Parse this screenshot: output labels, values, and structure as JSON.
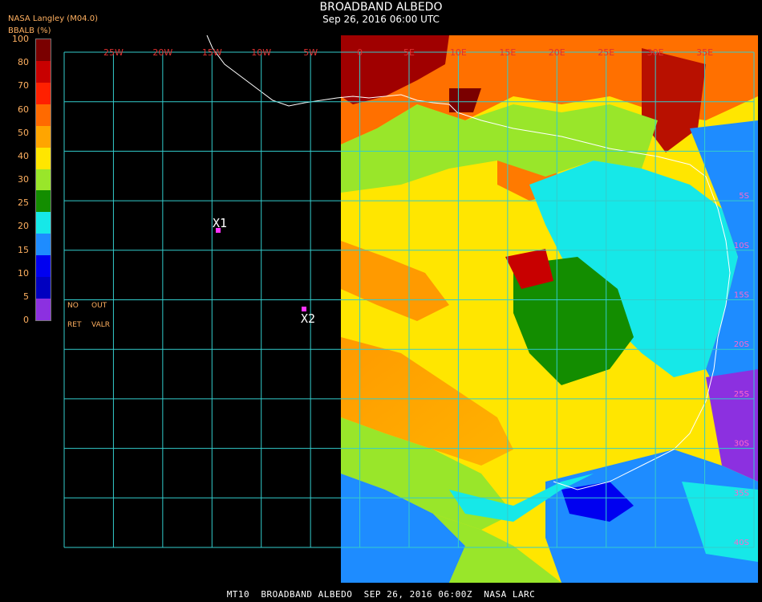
{
  "header": {
    "title": "BROADBAND ALBEDO",
    "subtitle": "Sep 26, 2016 06:00 UTC",
    "agency": "NASA Langley (M04.0)",
    "unit_label": "BBALB (%)"
  },
  "colorbar": {
    "ticks": [
      "100",
      "80",
      "70",
      "60",
      "50",
      "40",
      "30",
      "25",
      "20",
      "15",
      "10",
      "5",
      "0"
    ],
    "colors": [
      "#7a0000",
      "#c80000",
      "#ff2000",
      "#ff6a00",
      "#ffa500",
      "#ffe600",
      "#99e62a",
      "#138d00",
      "#16e8e8",
      "#1e8cff",
      "#0000f0",
      "#0000c0",
      "#8c30e0"
    ]
  },
  "legend_notes": {
    "no": "NO",
    "out": "OUT",
    "ret": "RET",
    "valr": "VALR"
  },
  "map": {
    "lon_labels": [
      "25W",
      "20W",
      "15W",
      "10W",
      "5W",
      "0",
      "5E",
      "10E",
      "15E",
      "20E",
      "25E",
      "30E",
      "35E"
    ],
    "lat_labels": [
      "5S",
      "10S",
      "15S",
      "20S",
      "25S",
      "30S",
      "35S",
      "40S"
    ],
    "points": [
      {
        "label": "X1"
      },
      {
        "label": "X2"
      }
    ],
    "palette": {
      "grid": "#33cccc",
      "coast": "#ffffff",
      "point": "#ff33ff"
    }
  },
  "footer": {
    "text": "MT10  BROADBAND ALBEDO  SEP 26, 2016 06:00Z  NASA LARC"
  }
}
